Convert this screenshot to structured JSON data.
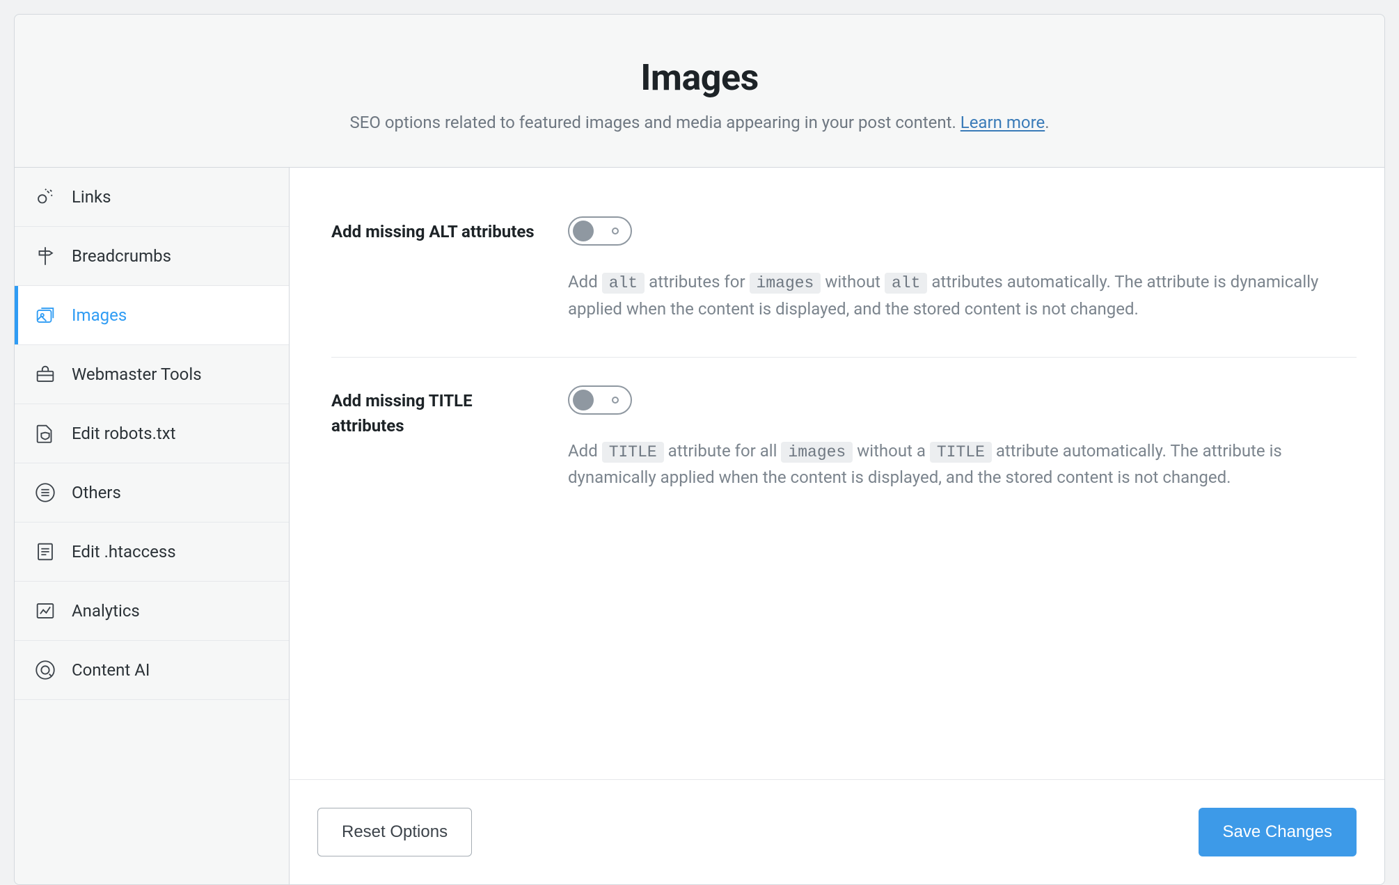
{
  "header": {
    "title": "Images",
    "subtitle_prefix": "SEO options related to featured images and media appearing in your post content. ",
    "learn_more": "Learn more",
    "subtitle_suffix": "."
  },
  "sidebar": {
    "items": [
      {
        "key": "links",
        "label": "Links"
      },
      {
        "key": "breadcrumbs",
        "label": "Breadcrumbs"
      },
      {
        "key": "images",
        "label": "Images"
      },
      {
        "key": "webmaster-tools",
        "label": "Webmaster Tools"
      },
      {
        "key": "edit-robots",
        "label": "Edit robots.txt"
      },
      {
        "key": "others",
        "label": "Others"
      },
      {
        "key": "edit-htaccess",
        "label": "Edit .htaccess"
      },
      {
        "key": "analytics",
        "label": "Analytics"
      },
      {
        "key": "content-ai",
        "label": "Content AI"
      }
    ],
    "active_key": "images"
  },
  "settings": {
    "alt": {
      "label": "Add missing ALT attributes",
      "enabled": false,
      "desc_parts": {
        "t1": "Add ",
        "c1": "alt",
        "t2": " attributes for ",
        "c2": "images",
        "t3": " without ",
        "c3": "alt",
        "t4": " attributes automatically. The attribute is dynamically applied when the content is displayed, and the stored content is not changed."
      }
    },
    "title": {
      "label": "Add missing TITLE attributes",
      "enabled": false,
      "desc_parts": {
        "t1": "Add ",
        "c1": "TITLE",
        "t2": " attribute for all ",
        "c2": "images",
        "t3": " without a ",
        "c3": "TITLE",
        "t4": " attribute automatically. The attribute is dynamically applied when the content is displayed, and the stored content is not changed."
      }
    }
  },
  "footer": {
    "reset_label": "Reset Options",
    "save_label": "Save Changes"
  }
}
